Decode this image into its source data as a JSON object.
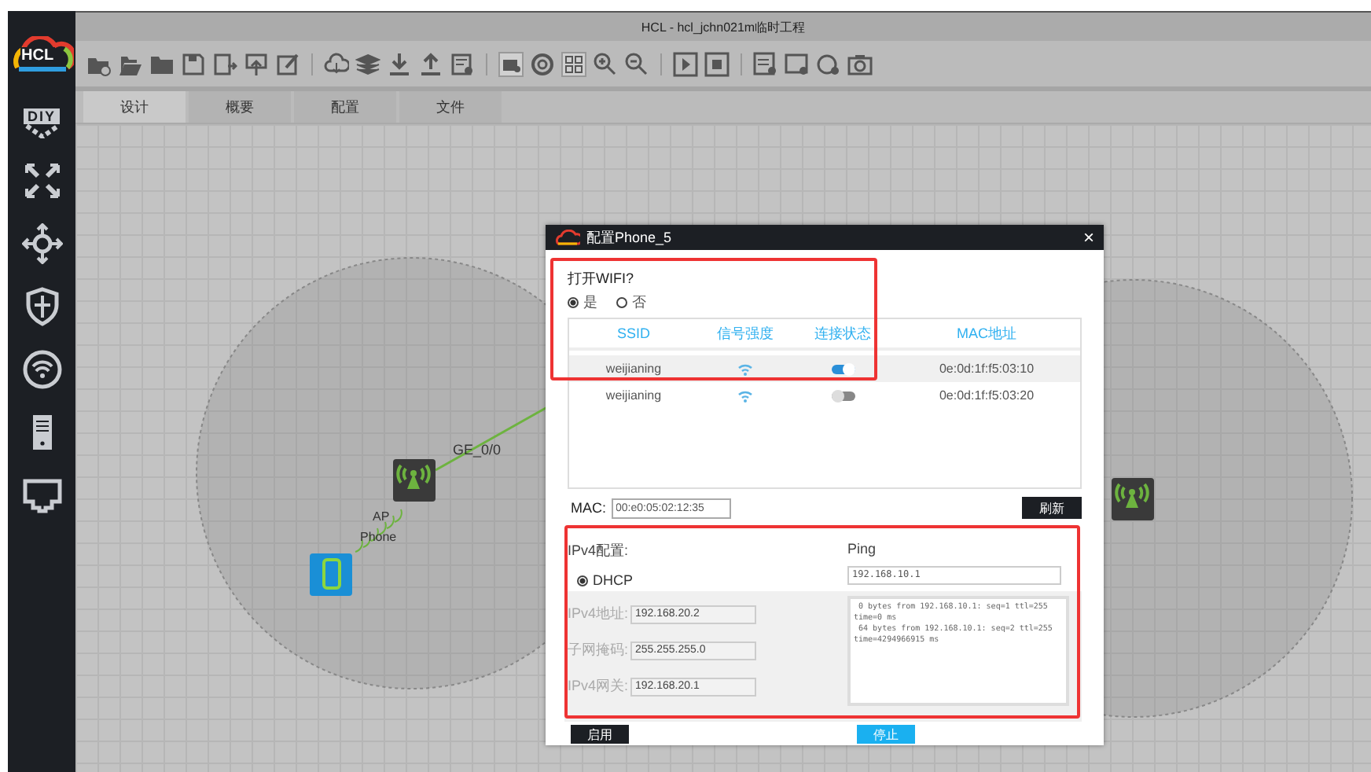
{
  "window": {
    "title": "HCL - hcl_jchn021m临时工程"
  },
  "logo": "HCL",
  "sidebar": {
    "diy_label": "DIY"
  },
  "tabs": [
    {
      "label": "设计",
      "selected": true
    },
    {
      "label": "概要",
      "selected": false
    },
    {
      "label": "配置",
      "selected": false
    },
    {
      "label": "文件",
      "selected": false
    }
  ],
  "canvas": {
    "link_label": "GE_0/0",
    "ap_label": "AP",
    "phone_label": "Phone"
  },
  "dialog": {
    "title": "配置Phone_5",
    "close": "×",
    "wifi_question": "打开WIFI?",
    "wifi_options": [
      {
        "label": "是",
        "selected": true
      },
      {
        "label": "否",
        "selected": false
      }
    ],
    "wifi_table": {
      "columns": [
        "SSID",
        "信号强度",
        "连接状态",
        "MAC地址"
      ],
      "rows": [
        {
          "ssid": "weijianing",
          "connected": true,
          "mac": "0e:0d:1f:f5:03:10",
          "selected": true
        },
        {
          "ssid": "weijianing",
          "connected": false,
          "mac": "0e:0d:1f:f5:03:20",
          "selected": false
        }
      ]
    },
    "mac": {
      "label": "MAC:",
      "value": "00:e0:05:02:12:35"
    },
    "refresh": "刷新",
    "ipv4": {
      "title": "IPv4配置:",
      "dhcp": {
        "label": "DHCP",
        "selected": true
      },
      "disabled": true,
      "fields": [
        {
          "label": "IPv4地址:",
          "value": "192.168.20.2"
        },
        {
          "label": "子网掩码:",
          "value": "255.255.255.0"
        },
        {
          "label": "IPv4网关:",
          "value": "192.168.20.1"
        }
      ]
    },
    "ping": {
      "title": "Ping",
      "target": "192.168.10.1",
      "output": [
        " 0 bytes from 192.168.10.1: seq=1 ttl=255 time=0 ms",
        " 64 bytes from 192.168.10.1: seq=2 ttl=255 time=4294966915 ms"
      ]
    },
    "buttons": [
      {
        "label": "启用",
        "kind": "dark"
      },
      {
        "label": "停止",
        "kind": "primary"
      }
    ]
  }
}
